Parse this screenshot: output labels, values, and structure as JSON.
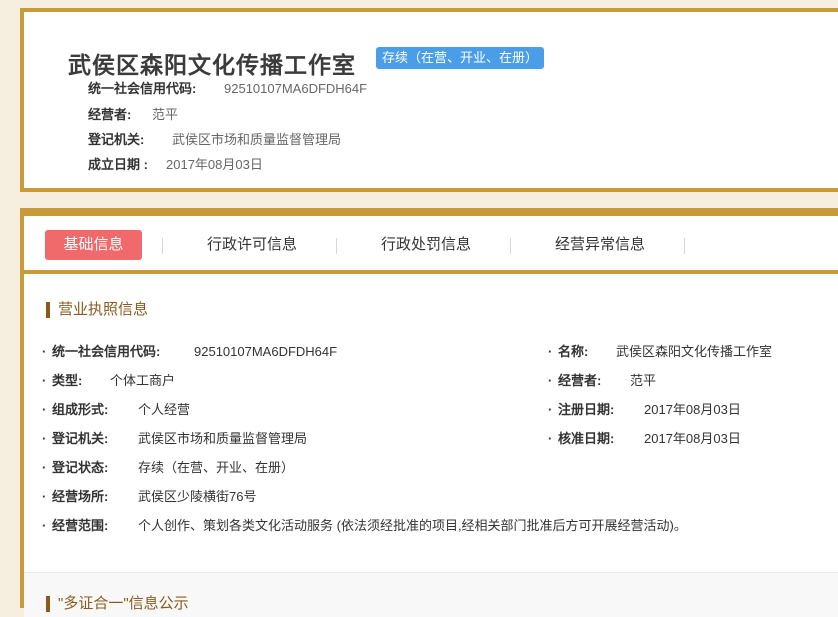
{
  "header": {
    "company_name": "武侯区森阳文化传播工作室",
    "status_badge": "存续（在营、开业、在册）",
    "rows": [
      {
        "label": "统一社会信用代码:",
        "value": "92510107MA6DFDH64F"
      },
      {
        "label": "经营者:",
        "value": "范平"
      },
      {
        "label": "登记机关:",
        "value": "武侯区市场和质量监督管理局"
      },
      {
        "label": "成立日期 :",
        "value": "2017年08月03日"
      }
    ]
  },
  "tabs": [
    {
      "label": "基础信息",
      "active": true
    },
    {
      "label": "行政许可信息",
      "active": false
    },
    {
      "label": "行政处罚信息",
      "active": false
    },
    {
      "label": "经营异常信息",
      "active": false
    }
  ],
  "license_section": {
    "title": "营业执照信息",
    "left_rows": [
      {
        "label": "统一社会信用代码:",
        "value": "92510107MA6DFDH64F"
      },
      {
        "label": "类型:",
        "value": "个体工商户"
      },
      {
        "label": "组成形式:",
        "value": "个人经营"
      },
      {
        "label": "登记机关:",
        "value": "武侯区市场和质量监督管理局"
      },
      {
        "label": "登记状态:",
        "value": "存续（在营、开业、在册）"
      },
      {
        "label": "经营场所:",
        "value": "武侯区少陵横街76号"
      },
      {
        "label": "经营范围:",
        "value": "个人创作、策划各类文化活动服务 (依法须经批准的项目,经相关部门批准后方可开展经营活动)。"
      }
    ],
    "right_rows": [
      {
        "label": "名称:",
        "value": "武侯区森阳文化传播工作室"
      },
      {
        "label": "经营者:",
        "value": "范平"
      },
      {
        "label": "注册日期:",
        "value": "2017年08月03日"
      },
      {
        "label": "核准日期:",
        "value": "2017年08月03日"
      }
    ]
  },
  "next_section": {
    "title": "\"多证合一\"信息公示"
  },
  "colors": {
    "frame": "#c99a38",
    "badge": "#4a9ee8",
    "active_tab": "#f0696b",
    "section_title": "#8a5a1c"
  }
}
